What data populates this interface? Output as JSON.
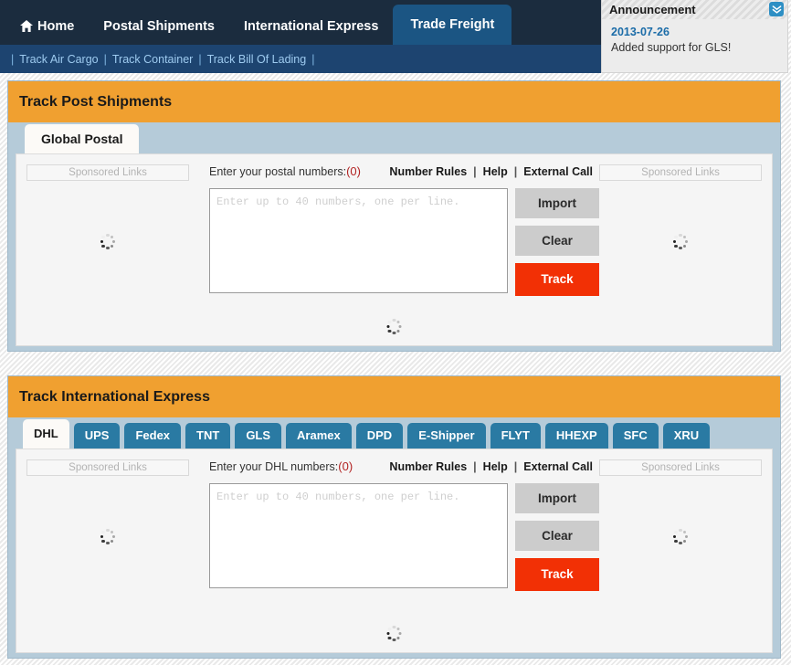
{
  "topnav": {
    "items": [
      {
        "label": "Home",
        "icon": "home-icon",
        "active": false
      },
      {
        "label": "Postal Shipments",
        "icon": null,
        "active": false
      },
      {
        "label": "International Express",
        "icon": null,
        "active": false
      },
      {
        "label": "Trade Freight",
        "icon": null,
        "active": true
      }
    ]
  },
  "subnav": {
    "links": [
      "Track Air Cargo",
      "Track Container",
      "Track Bill Of Lading"
    ],
    "separator": "|"
  },
  "announcement": {
    "title": "Announcement",
    "toggle_icon": "chevron-double-down-icon",
    "date": "2013-07-26",
    "text": "Added support for GLS!"
  },
  "panels": [
    {
      "id": "postal",
      "title": "Track Post Shipments",
      "tabs": [
        {
          "label": "Global Postal",
          "active": true
        }
      ],
      "sponsored_left": "Sponsored Links",
      "sponsored_right": "Sponsored Links",
      "form": {
        "label": "Enter your postal numbers:",
        "count": "(0)",
        "links": [
          "Number Rules",
          "Help",
          "External Call"
        ],
        "link_separator": "|",
        "textarea_value": "",
        "textarea_placeholder": "Enter up to 40 numbers, one per line.",
        "buttons": {
          "import": "Import",
          "clear": "Clear",
          "track": "Track"
        }
      }
    },
    {
      "id": "express",
      "title": "Track International Express",
      "tabs": [
        {
          "label": "DHL",
          "active": true
        },
        {
          "label": "UPS",
          "active": false
        },
        {
          "label": "Fedex",
          "active": false
        },
        {
          "label": "TNT",
          "active": false
        },
        {
          "label": "GLS",
          "active": false
        },
        {
          "label": "Aramex",
          "active": false
        },
        {
          "label": "DPD",
          "active": false
        },
        {
          "label": "E-Shipper",
          "active": false
        },
        {
          "label": "FLYT",
          "active": false
        },
        {
          "label": "HHEXP",
          "active": false
        },
        {
          "label": "SFC",
          "active": false
        },
        {
          "label": "XRU",
          "active": false
        }
      ],
      "sponsored_left": "Sponsored Links",
      "sponsored_right": "Sponsored Links",
      "form": {
        "label": "Enter your DHL numbers:",
        "count": "(0)",
        "links": [
          "Number Rules",
          "Help",
          "External Call"
        ],
        "link_separator": "|",
        "textarea_value": "",
        "textarea_placeholder": "Enter up to 40 numbers, one per line.",
        "buttons": {
          "import": "Import",
          "clear": "Clear",
          "track": "Track"
        }
      }
    }
  ],
  "colors": {
    "nav_dark": "#1b2c3e",
    "nav_active": "#1b5583",
    "subnav": "#1d4470",
    "panel_header_orange": "#f0a030",
    "panel_body_blue": "#b5cbd9",
    "tab_blue": "#2a7aa3",
    "track_red": "#f23005",
    "button_gray": "#cccccc",
    "link_blue": "#9ecbf0",
    "date_blue": "#1b6ca8",
    "count_red": "#b22222"
  }
}
